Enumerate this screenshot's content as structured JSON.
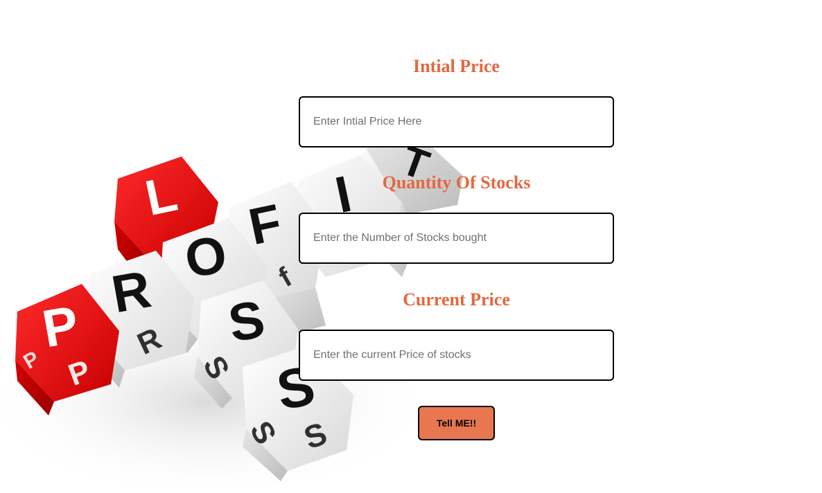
{
  "form": {
    "initial_price": {
      "label": "Intial Price",
      "placeholder": "Enter Intial Price Here",
      "value": ""
    },
    "quantity": {
      "label": "Quantity Of Stocks",
      "placeholder": "Enter the Number of Stocks bought",
      "value": ""
    },
    "current_price": {
      "label": "Current Price",
      "placeholder": "Enter the current Price of stocks",
      "value": ""
    },
    "submit_label": "Tell ME!!"
  },
  "illustration": {
    "name": "profit-loss-cubes",
    "letters": {
      "p": "P",
      "r": "R",
      "o": "O",
      "f": "F",
      "i": "I",
      "t": "T",
      "l": "L",
      "s1": "S",
      "s2": "S"
    },
    "colors": {
      "red_cube": "#e30a0a",
      "white_cube": "#f2f2f2",
      "accent": "#e4673f"
    }
  }
}
